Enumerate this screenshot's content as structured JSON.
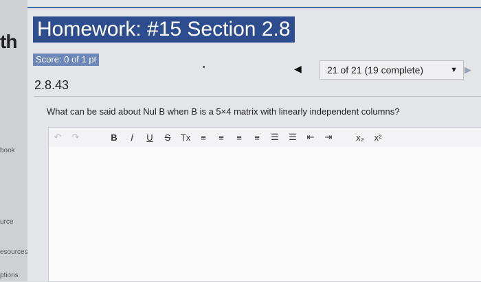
{
  "sidebar": {
    "brand": "th",
    "items": [
      "book",
      "urce",
      "esources",
      "ptions"
    ]
  },
  "header": {
    "title": "Homework: #15 Section 2.8",
    "score": "Score: 0 of 1 pt"
  },
  "navigator": {
    "prev_symbol": "◀",
    "status": "21 of 21 (19 complete)",
    "dropdown_symbol": "▼",
    "next_symbol": "▶"
  },
  "question": {
    "number": "2.8.43",
    "text": "What can be said about Nul B when B is a 5×4 matrix with linearly independent columns?"
  },
  "toolbar": {
    "buttons": [
      {
        "name": "undo-icon",
        "glyph": "↶"
      },
      {
        "name": "redo-icon",
        "glyph": "↷"
      },
      {
        "name": "bold-button",
        "glyph": "B"
      },
      {
        "name": "italic-button",
        "glyph": "I"
      },
      {
        "name": "underline-button",
        "glyph": "U"
      },
      {
        "name": "strikethrough-button",
        "glyph": "S"
      },
      {
        "name": "clear-format-button",
        "glyph": "Tx"
      },
      {
        "name": "align-left-icon",
        "glyph": "≡"
      },
      {
        "name": "align-center-icon",
        "glyph": "≡"
      },
      {
        "name": "align-right-icon",
        "glyph": "≡"
      },
      {
        "name": "align-justify-icon",
        "glyph": "≡"
      },
      {
        "name": "bullet-list-icon",
        "glyph": "☰"
      },
      {
        "name": "numbered-list-icon",
        "glyph": "☰"
      },
      {
        "name": "outdent-icon",
        "glyph": "⇤"
      },
      {
        "name": "indent-icon",
        "glyph": "⇥"
      },
      {
        "name": "subscript-button",
        "glyph": "x₂"
      },
      {
        "name": "superscript-button",
        "glyph": "x²"
      }
    ]
  }
}
